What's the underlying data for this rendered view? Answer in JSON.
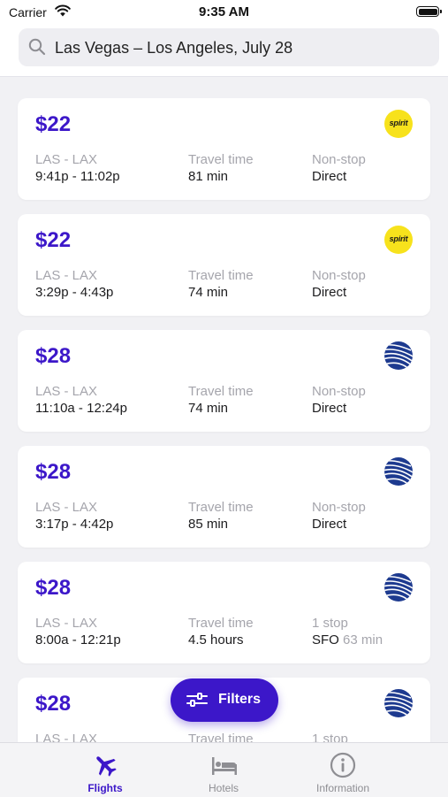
{
  "status_bar": {
    "carrier": "Carrier",
    "time": "9:35 AM"
  },
  "search": {
    "query": "Las Vegas – Los Angeles, July 28"
  },
  "labels": {
    "travel_time": "Travel time"
  },
  "flights": [
    {
      "price": "$22",
      "airline_logo": "spirit-logo",
      "route": "LAS - LAX",
      "times": "9:41p - 11:02p",
      "duration": "81 min",
      "stops_label": "Non-stop",
      "stops_value": "Direct",
      "layover": ""
    },
    {
      "price": "$22",
      "airline_logo": "spirit-logo",
      "route": "LAS - LAX",
      "times": "3:29p - 4:43p",
      "duration": "74 min",
      "stops_label": "Non-stop",
      "stops_value": "Direct",
      "layover": ""
    },
    {
      "price": "$28",
      "airline_logo": "united-globe-logo",
      "route": "LAS - LAX",
      "times": "11:10a - 12:24p",
      "duration": "74 min",
      "stops_label": "Non-stop",
      "stops_value": "Direct",
      "layover": ""
    },
    {
      "price": "$28",
      "airline_logo": "united-globe-logo",
      "route": "LAS - LAX",
      "times": "3:17p - 4:42p",
      "duration": "85 min",
      "stops_label": "Non-stop",
      "stops_value": "Direct",
      "layover": ""
    },
    {
      "price": "$28",
      "airline_logo": "united-globe-logo",
      "route": "LAS - LAX",
      "times": "8:00a - 12:21p",
      "duration": "4.5 hours",
      "stops_label": "1 stop",
      "stops_value": "SFO",
      "layover": "63 min"
    },
    {
      "price": "$28",
      "airline_logo": "united-globe-logo",
      "route": "LAS - LAX",
      "times": "",
      "duration": "",
      "stops_label": "1 stop",
      "stops_value": "",
      "layover": ""
    }
  ],
  "spirit_logo_text": "spirit",
  "filters_button": {
    "label": "Filters"
  },
  "tabs": [
    {
      "label": "Flights",
      "icon": "airplane-icon",
      "active": true
    },
    {
      "label": "Hotels",
      "icon": "bed-icon",
      "active": false
    },
    {
      "label": "Information",
      "icon": "info-circle-icon",
      "active": false
    }
  ],
  "colors": {
    "accent": "#3c17c9",
    "spirit_yellow": "#f7e21c",
    "united_blue": "#1d3a8f",
    "muted_text": "#a5a5ac"
  }
}
